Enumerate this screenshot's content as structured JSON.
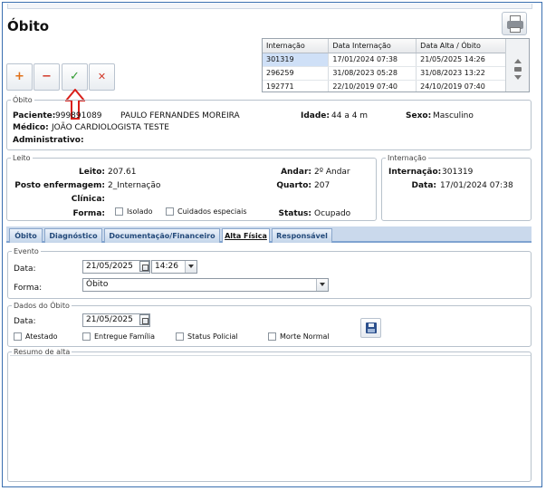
{
  "title": "Óbito",
  "toolbar": {
    "add": "+",
    "remove": "−",
    "confirm": "✓",
    "cancel": "✕"
  },
  "colors": {
    "add": "#e0711a",
    "remove": "#d23a2a",
    "confirm": "#2f9a2f",
    "cancel": "#d23a2a",
    "arrow": "#d9201a",
    "accent": "#7fa3d1"
  },
  "admissions_grid": {
    "columns": [
      "Internação",
      "Data Internação",
      "Data Alta / Óbito"
    ],
    "rows": [
      [
        "301319",
        "17/01/2024 07:38",
        "21/05/2025 14:26"
      ],
      [
        "296259",
        "31/08/2023 05:28",
        "31/08/2023 13:22"
      ],
      [
        "192771",
        "22/10/2019 07:40",
        "24/10/2019 07:40"
      ]
    ]
  },
  "obito_section": {
    "legend": "Óbito",
    "patient_label": "Paciente:",
    "patient_id": "999891089",
    "patient_name": "PAULO FERNANDES MOREIRA",
    "age_label": "Idade:",
    "age_value": "44 a 4 m",
    "sex_label": "Sexo:",
    "sex_value": "Masculino",
    "doctor_label": "Médico:",
    "doctor_value": "JOÃO CARDIOLOGISTA TESTE",
    "admin_label": "Administrativo:"
  },
  "leito_section": {
    "legend": "Leito",
    "bed_label": "Leito:",
    "bed_value": "207.61",
    "station_label": "Posto enfermagem:",
    "station_value": "2_Internação",
    "clinic_label": "Clínica:",
    "form_label": "Forma:",
    "isolated_label": "Isolado",
    "special_care_label": "Cuidados especiais",
    "floor_label": "Andar:",
    "floor_value": "2º Andar",
    "room_label": "Quarto:",
    "room_value": "207",
    "status_label": "Status:",
    "status_value": "Ocupado"
  },
  "internacao_section": {
    "legend": "Internação",
    "number_label": "Internação:",
    "number_value": "301319",
    "date_label": "Data:",
    "date_value": "17/01/2024 07:38"
  },
  "tabs": [
    "Óbito",
    "Diagnóstico",
    "Documentação/Financeiro",
    "Alta Física",
    "Responsável"
  ],
  "evento": {
    "legend": "Evento",
    "date_label": "Data:",
    "date_value": "21/05/2025",
    "time_value": "14:26",
    "form_label": "Forma:",
    "form_value": "Óbito"
  },
  "dados_obito": {
    "legend": "Dados do Óbito",
    "date_label": "Data:",
    "date_value": "21/05/2025",
    "checks": [
      "Atestado",
      "Entregue Família",
      "Status Policial",
      "Morte Normal"
    ]
  },
  "resumo": {
    "legend": "Resumo de alta"
  }
}
